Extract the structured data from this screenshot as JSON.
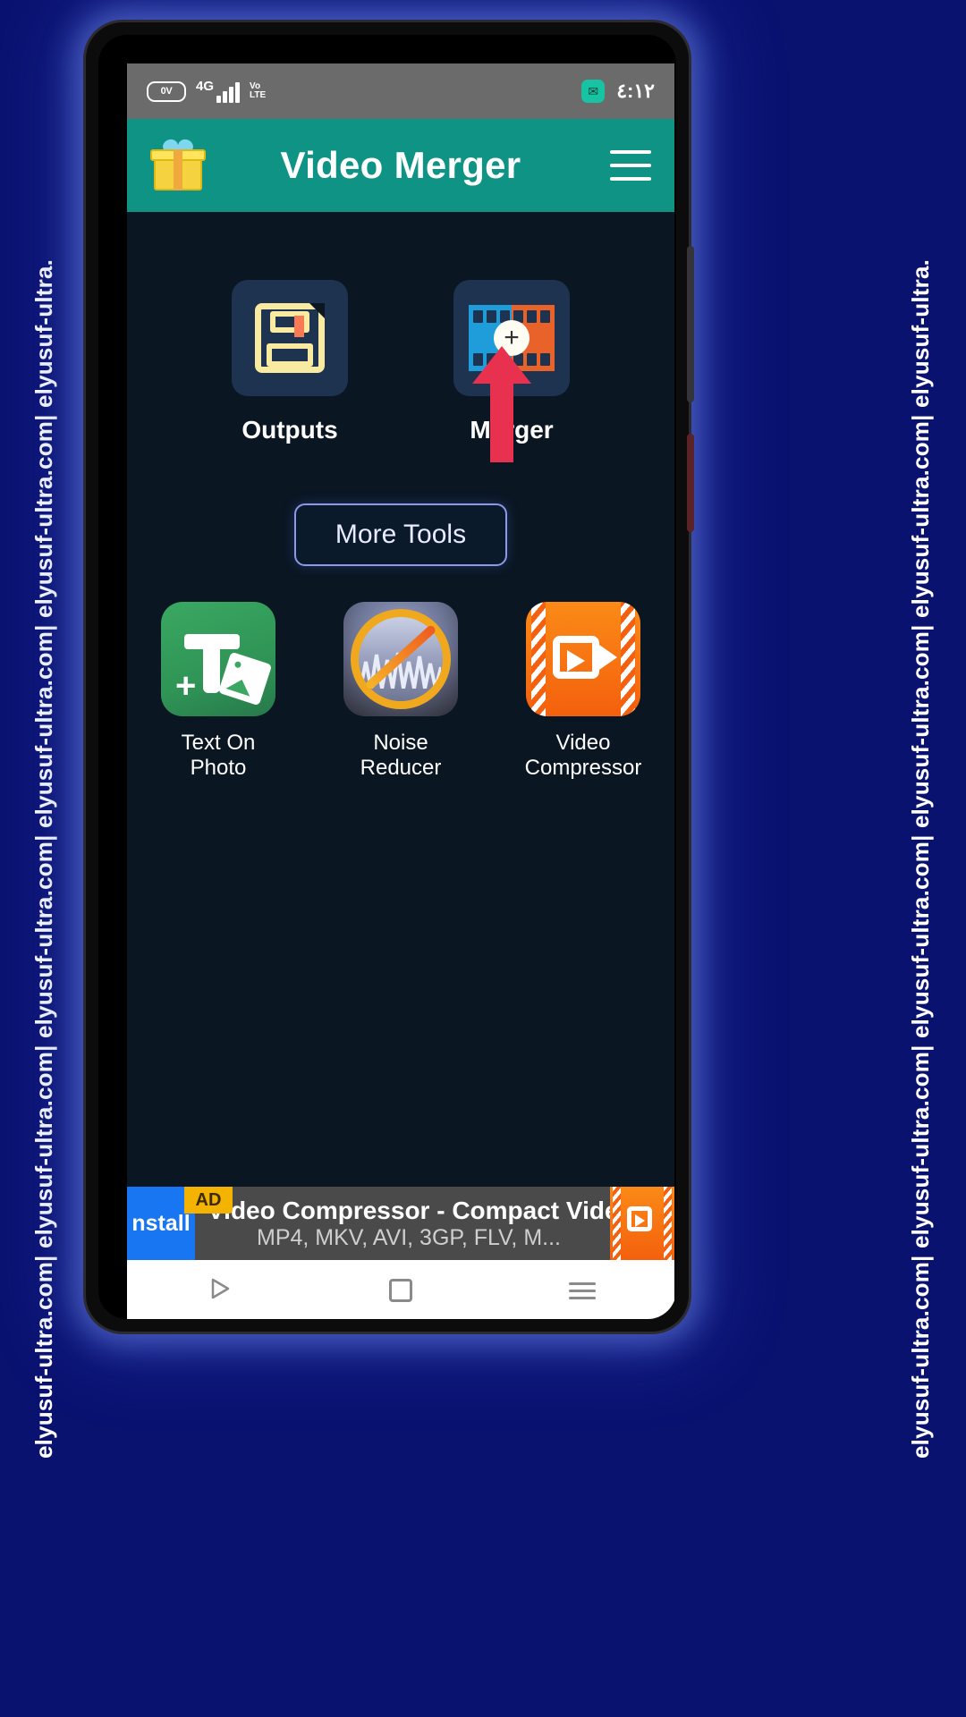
{
  "watermark": {
    "text": "elyusuf-ultra.com| elyusuf-ultra.com| elyusuf-ultra.com| elyusuf-ultra.com| elyusuf-ultra.com| elyusuf-ultra."
  },
  "statusbar": {
    "battery_label": "0V",
    "network": "4G",
    "volte_top": "Vo",
    "volte_bottom": "LTE",
    "notification_icon": "message-icon",
    "time": "٤:١٢"
  },
  "appbar": {
    "gift_icon": "gift-icon",
    "title": "Video Merger",
    "menu_icon": "hamburger-menu-icon"
  },
  "main": {
    "top_tiles": [
      {
        "icon": "floppy-disk-icon",
        "label": "Outputs"
      },
      {
        "icon": "film-strip-plus-icon",
        "label": "Merger"
      }
    ],
    "more_tools_label": "More Tools",
    "tools": [
      {
        "icon": "text-on-photo-icon",
        "label_line1": "Text On",
        "label_line2": "Photo"
      },
      {
        "icon": "noise-reducer-icon",
        "label_line1": "Noise",
        "label_line2": "Reducer"
      },
      {
        "icon": "video-compressor-icon",
        "label_line1": "Video",
        "label_line2": "Compressor"
      }
    ],
    "pointer_icon": "red-up-arrow-annotation"
  },
  "ad": {
    "install_label": "nstall",
    "badge": "AD",
    "title": "Video Compressor - Compact Video C...",
    "subtitle": "MP4, MKV, AVI, 3GP, FLV, M...",
    "app_icon": "video-compressor-icon"
  },
  "navbar": {
    "back_icon": "back-triangle-icon",
    "home_icon": "home-square-icon",
    "recents_icon": "recents-lines-icon"
  },
  "colors": {
    "accent": "#0f9384",
    "background": "#0a1622",
    "tile": "#1d3350",
    "arrow": "#e8304f",
    "page_bg": "#0a1270"
  }
}
